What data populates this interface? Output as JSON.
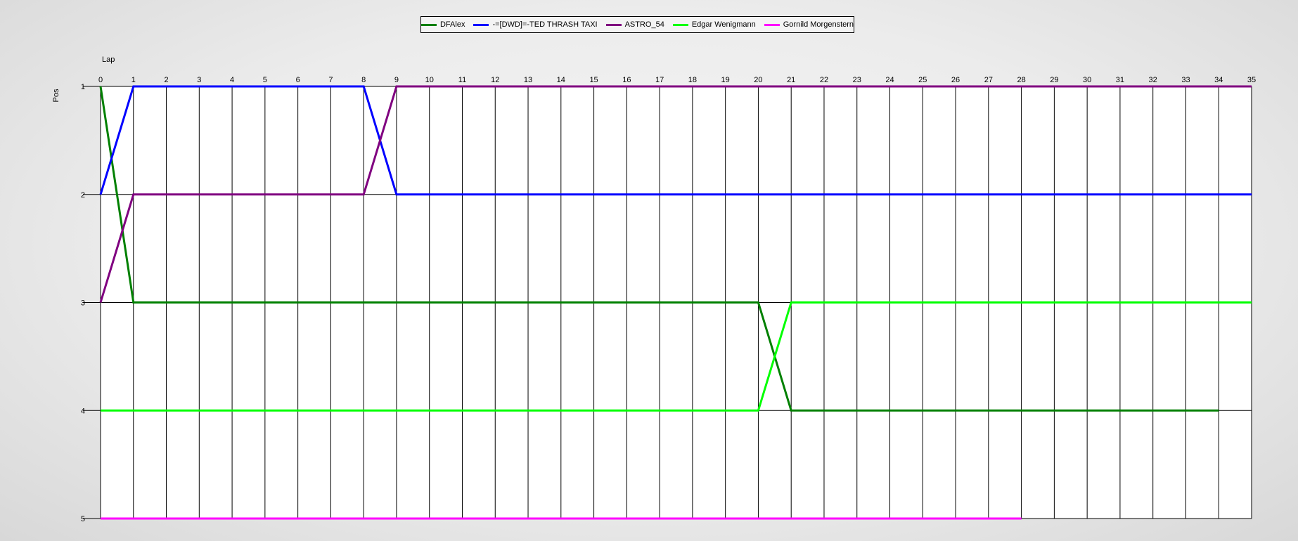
{
  "chart_data": {
    "type": "line",
    "xlabel": "Lap",
    "ylabel": "Pos",
    "xlim": [
      0,
      35
    ],
    "ylim": [
      1,
      5
    ],
    "y_inverted": true,
    "grid": true,
    "legend_position": "top-center",
    "x_ticks": [
      0,
      1,
      2,
      3,
      4,
      5,
      6,
      7,
      8,
      9,
      10,
      11,
      12,
      13,
      14,
      15,
      16,
      17,
      18,
      19,
      20,
      21,
      22,
      23,
      24,
      25,
      26,
      27,
      28,
      29,
      30,
      31,
      32,
      33,
      34,
      35
    ],
    "y_ticks": [
      1,
      2,
      3,
      4,
      5
    ],
    "series": [
      {
        "name": "DFAlex",
        "color": "#008000",
        "points": [
          [
            0,
            1
          ],
          [
            1,
            3
          ],
          [
            20,
            3
          ],
          [
            21,
            4
          ],
          [
            34,
            4
          ]
        ]
      },
      {
        "name": "-=[DWD]=-TED THRASH TAXI",
        "color": "#0000ff",
        "points": [
          [
            0,
            2
          ],
          [
            1,
            1
          ],
          [
            8,
            1
          ],
          [
            9,
            2
          ],
          [
            35,
            2
          ]
        ]
      },
      {
        "name": "ASTRO_54",
        "color": "#800080",
        "points": [
          [
            0,
            3
          ],
          [
            1,
            2
          ],
          [
            8,
            2
          ],
          [
            9,
            1
          ],
          [
            35,
            1
          ]
        ]
      },
      {
        "name": "Edgar Wenigmann",
        "color": "#00ff00",
        "points": [
          [
            0,
            4
          ],
          [
            20,
            4
          ],
          [
            21,
            3
          ],
          [
            35,
            3
          ]
        ]
      },
      {
        "name": "Gornild Morgenstern",
        "color": "#ff00ff",
        "points": [
          [
            0,
            5
          ],
          [
            28,
            5
          ]
        ]
      }
    ]
  }
}
